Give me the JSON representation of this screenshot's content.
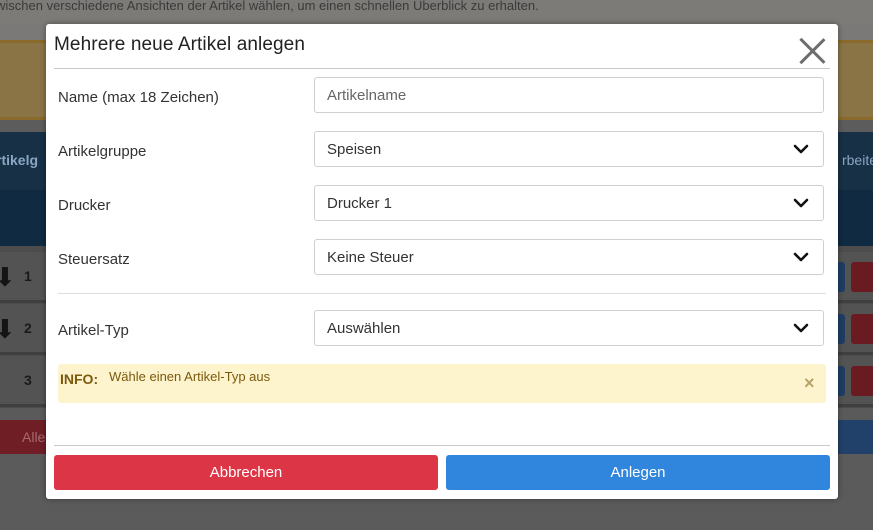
{
  "background": {
    "top_text": "wischen verschiedene Ansichten der Artikel wählen, um einen schnellen Überblick zu erhalten.",
    "nav_left": "rtikelg",
    "nav_right": "rbeite",
    "rows": [
      "1",
      "2",
      "3"
    ],
    "red_button": "Alle"
  },
  "modal": {
    "title": "Mehrere neue Artikel anlegen",
    "fields": {
      "name": {
        "label": "Name (max 18 Zeichen)",
        "placeholder": "Artikelname",
        "value": ""
      },
      "group": {
        "label": "Artikelgruppe",
        "value": "Speisen"
      },
      "printer": {
        "label": "Drucker",
        "value": "Drucker 1"
      },
      "tax": {
        "label": "Steuersatz",
        "value": "Keine Steuer"
      },
      "type": {
        "label": "Artikel-Typ",
        "value": "Auswählen"
      }
    },
    "info": {
      "label": "INFO:",
      "text": "Wähle einen Artikel-Typ aus",
      "close": "×"
    },
    "buttons": {
      "cancel": "Abbrechen",
      "create": "Anlegen"
    }
  },
  "colors": {
    "cancel": "#dc3545",
    "create": "#2f86dc",
    "info_bg": "#fdf3cd",
    "info_text": "#7b5a0d"
  }
}
